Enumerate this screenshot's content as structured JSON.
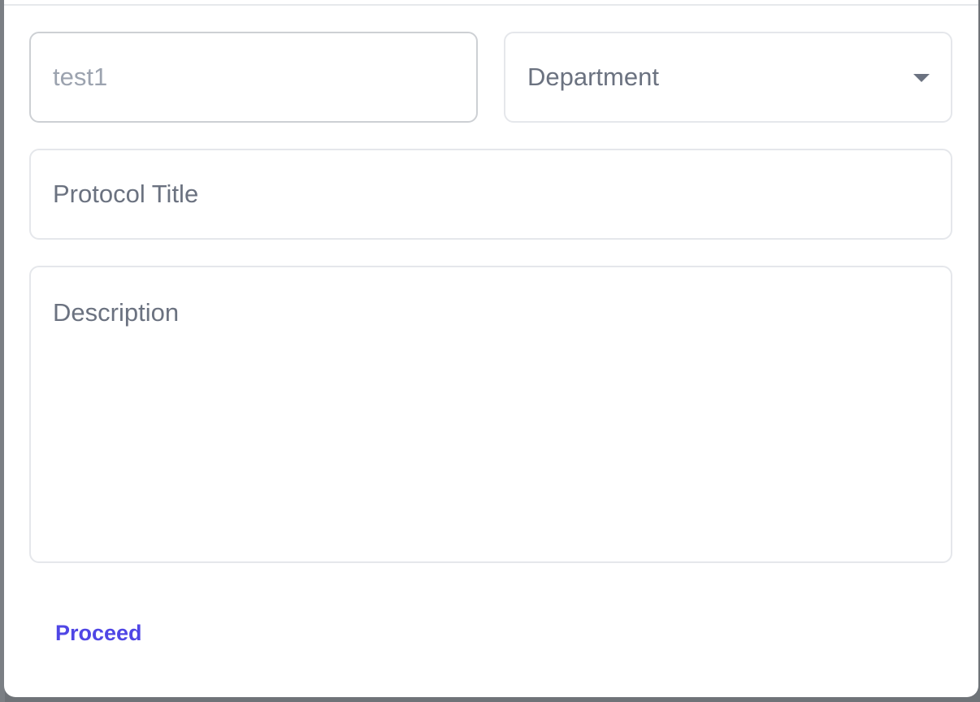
{
  "form": {
    "name_field": {
      "value": "test1"
    },
    "department_select": {
      "placeholder": "Department"
    },
    "protocol_title_field": {
      "placeholder": "Protocol Title"
    },
    "description_field": {
      "placeholder": "Description"
    },
    "proceed_label": "Proceed"
  },
  "colors": {
    "accent": "#4f46e5",
    "placeholder_text": "#6b7280",
    "value_text": "#9ca3af",
    "border": "#e5e7eb"
  }
}
